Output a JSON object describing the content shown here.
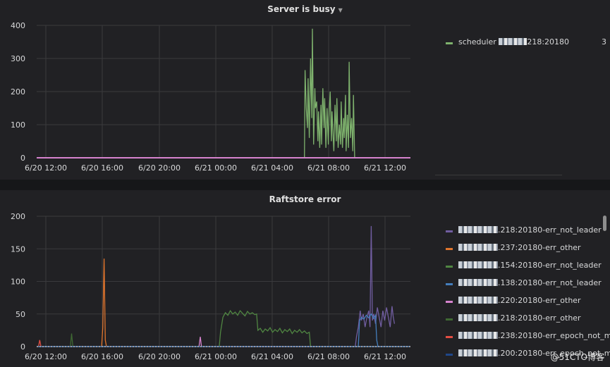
{
  "panels": [
    {
      "title": "Server is busy",
      "chart_data": {
        "type": "line",
        "x_ticks": [
          "6/20 12:00",
          "6/20 16:00",
          "6/20 20:00",
          "6/21 00:00",
          "6/21 04:00",
          "6/21 08:00",
          "6/21 12:00"
        ],
        "ylim": [
          0,
          400
        ],
        "y_ticks": [
          "0",
          "100",
          "200",
          "300",
          "400"
        ],
        "grid": true,
        "legend_position": "right",
        "series": [
          {
            "name": "scheduler ▆▆▆▆218:20180",
            "color": "#7eb26d",
            "points": [
              [
                0,
                0
              ],
              [
                43.5,
                0
              ],
              [
                43.7,
                0
              ],
              [
                43.8,
                265
              ],
              [
                44.0,
                150
              ],
              [
                44.2,
                90
              ],
              [
                44.3,
                240
              ],
              [
                44.5,
                60
              ],
              [
                44.7,
                300
              ],
              [
                44.9,
                120
              ],
              [
                45.0,
                390
              ],
              [
                45.2,
                40
              ],
              [
                45.4,
                210
              ],
              [
                45.5,
                150
              ],
              [
                45.7,
                170
              ],
              [
                45.9,
                50
              ],
              [
                46.0,
                140
              ],
              [
                46.2,
                30
              ],
              [
                46.4,
                160
              ],
              [
                46.5,
                40
              ],
              [
                46.7,
                210
              ],
              [
                46.9,
                90
              ],
              [
                47.0,
                180
              ],
              [
                47.2,
                30
              ],
              [
                47.4,
                150
              ],
              [
                47.6,
                40
              ],
              [
                47.7,
                120
              ],
              [
                47.9,
                200
              ],
              [
                48.1,
                50
              ],
              [
                48.2,
                140
              ],
              [
                48.4,
                60
              ],
              [
                48.5,
                20
              ],
              [
                48.7,
                160
              ],
              [
                48.9,
                50
              ],
              [
                49.0,
                180
              ],
              [
                49.2,
                30
              ],
              [
                49.4,
                100
              ],
              [
                49.6,
                40
              ],
              [
                49.7,
                170
              ],
              [
                49.9,
                30
              ],
              [
                50.1,
                120
              ],
              [
                50.2,
                60
              ],
              [
                50.4,
                190
              ],
              [
                50.5,
                20
              ],
              [
                50.7,
                130
              ],
              [
                50.9,
                30
              ],
              [
                51.0,
                290
              ],
              [
                51.2,
                60
              ],
              [
                51.4,
                120
              ],
              [
                51.6,
                20
              ],
              [
                51.7,
                190
              ],
              [
                51.9,
                0
              ],
              [
                52,
                0
              ],
              [
                61,
                0
              ]
            ]
          },
          {
            "name": "",
            "color": "#d683ce",
            "points": [
              [
                0,
                0
              ],
              [
                61,
                0
              ]
            ]
          }
        ]
      },
      "legend": [
        {
          "text_before": "scheduler",
          "text_after": "218:20180",
          "value": "3",
          "color": "#7eb26d"
        }
      ]
    },
    {
      "title": "Raftstore error",
      "chart_data": {
        "type": "line",
        "x_ticks": [
          "6/20 12:00",
          "6/20 16:00",
          "6/20 20:00",
          "6/21 00:00",
          "6/21 04:00",
          "6/21 08:00",
          "6/21 12:00"
        ],
        "ylim": [
          0,
          200
        ],
        "y_ticks": [
          "0",
          "50",
          "100",
          "150",
          "200"
        ],
        "grid": true,
        "legend_position": "right",
        "series": [
          {
            "name": "▆▆▆.218:20180-err_not_leader",
            "color": "#705da0",
            "points": [
              [
                0,
                0
              ],
              [
                52.0,
                0
              ],
              [
                52.2,
                15
              ],
              [
                52.5,
                30
              ],
              [
                52.8,
                55
              ],
              [
                53.0,
                40
              ],
              [
                53.3,
                50
              ],
              [
                53.6,
                30
              ],
              [
                53.9,
                45
              ],
              [
                54.2,
                55
              ],
              [
                54.4,
                30
              ],
              [
                54.6,
                185
              ],
              [
                54.8,
                40
              ],
              [
                55.0,
                50
              ],
              [
                55.3,
                35
              ],
              [
                55.6,
                60
              ],
              [
                55.9,
                45
              ],
              [
                56.2,
                30
              ],
              [
                56.5,
                55
              ],
              [
                56.8,
                40
              ],
              [
                57.1,
                60
              ],
              [
                57.4,
                45
              ],
              [
                57.7,
                30
              ],
              [
                58.0,
                62
              ],
              [
                58.2,
                45
              ],
              [
                58.4,
                35
              ]
            ]
          },
          {
            "name": "▆▆▆.237:20180-err_other",
            "color": "#e0752d",
            "points": [
              [
                0,
                0
              ],
              [
                10.6,
                0
              ],
              [
                10.8,
                30
              ],
              [
                11.0,
                135
              ],
              [
                11.2,
                10
              ],
              [
                11.4,
                0
              ],
              [
                61,
                0
              ]
            ]
          },
          {
            "name": "▆▆▆.154:20180-err_not_leader",
            "color": "#508642",
            "points": [
              [
                0,
                0
              ],
              [
                29.8,
                0
              ],
              [
                30,
                22
              ],
              [
                30.4,
                45
              ],
              [
                30.8,
                52
              ],
              [
                31.2,
                48
              ],
              [
                31.6,
                55
              ],
              [
                32.0,
                50
              ],
              [
                32.4,
                53
              ],
              [
                32.8,
                48
              ],
              [
                33.2,
                55
              ],
              [
                33.6,
                51
              ],
              [
                34.0,
                47
              ],
              [
                34.4,
                54
              ],
              [
                34.8,
                50
              ],
              [
                35.2,
                52
              ],
              [
                35.6,
                49
              ],
              [
                35.9,
                50
              ],
              [
                36.1,
                25
              ],
              [
                36.5,
                28
              ],
              [
                36.9,
                22
              ],
              [
                37.3,
                27
              ],
              [
                37.7,
                24
              ],
              [
                38.1,
                29
              ],
              [
                38.5,
                22
              ],
              [
                38.9,
                26
              ],
              [
                39.3,
                23
              ],
              [
                39.7,
                28
              ],
              [
                40.1,
                21
              ],
              [
                40.5,
                26
              ],
              [
                40.9,
                23
              ],
              [
                41.3,
                27
              ],
              [
                41.7,
                20
              ],
              [
                42.1,
                25
              ],
              [
                42.5,
                22
              ],
              [
                42.9,
                26
              ],
              [
                43.3,
                21
              ],
              [
                43.7,
                24
              ],
              [
                44.1,
                20
              ],
              [
                44.5,
                22
              ],
              [
                44.7,
                0
              ],
              [
                61,
                0
              ]
            ]
          },
          {
            "name": "▆▆▆.138:20180-err_not_leader",
            "color": "#447ebc",
            "points": [
              [
                0,
                0
              ],
              [
                52.5,
                0
              ],
              [
                52.7,
                40
              ],
              [
                53.0,
                45
              ],
              [
                53.4,
                42
              ],
              [
                53.8,
                48
              ],
              [
                54.2,
                44
              ],
              [
                54.6,
                50
              ],
              [
                55.0,
                43
              ],
              [
                55.3,
                48
              ],
              [
                55.5,
                10
              ],
              [
                55.7,
                0
              ],
              [
                61,
                0
              ]
            ]
          },
          {
            "name": "▆▆▆.220:20180-err_other",
            "color": "#d683ce",
            "points": [
              [
                0,
                0
              ],
              [
                26.5,
                0
              ],
              [
                26.7,
                15
              ],
              [
                26.9,
                0
              ],
              [
                61,
                0
              ]
            ]
          },
          {
            "name": "▆▆▆.218:20180-err_other",
            "color": "#3f6833",
            "points": [
              [
                0,
                0
              ],
              [
                5.5,
                0
              ],
              [
                5.7,
                20
              ],
              [
                5.9,
                0
              ],
              [
                61,
                0
              ]
            ]
          },
          {
            "name": "▆▆▆.238:20180-err_epoch_not_m",
            "color": "#e24d42",
            "points": [
              [
                0,
                0
              ],
              [
                0.3,
                0
              ],
              [
                0.5,
                10
              ],
              [
                0.7,
                0
              ],
              [
                61,
                0
              ]
            ]
          },
          {
            "name": "▆▆▆.200:20180-err_epoch_not_m",
            "color": "#1f78c1",
            "points": [
              [
                0,
                0
              ],
              [
                61,
                0
              ]
            ]
          }
        ]
      },
      "legend": [
        {
          "text": ".218:20180-err_not_leader",
          "color": "#705da0"
        },
        {
          "text": ".237:20180-err_other",
          "color": "#e0752d"
        },
        {
          "text": ".154:20180-err_not_leader",
          "color": "#508642"
        },
        {
          "text": ".138:20180-err_not_leader",
          "color": "#447ebc"
        },
        {
          "text": ".220:20180-err_other",
          "color": "#d683ce"
        },
        {
          "text": ".218:20180-err_other",
          "color": "#3f6833"
        },
        {
          "text": ".238:20180-err_epoch_not_m",
          "color": "#e24d42"
        },
        {
          "text": ".200:20180-err_epoch_not_m",
          "color": "#1f4788"
        }
      ]
    }
  ],
  "watermark": "@51CTO博客"
}
